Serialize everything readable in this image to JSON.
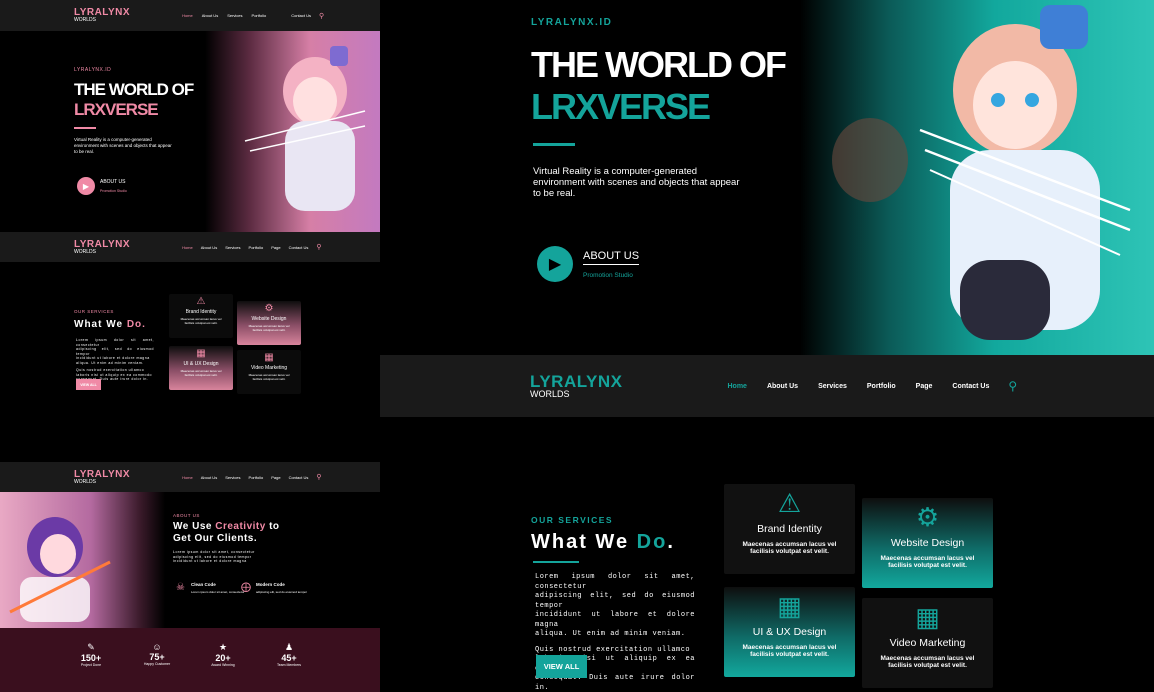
{
  "brand": {
    "name": "LYRALYNX",
    "sub": "WORLDS",
    "tag": "LYRALYNX.ID"
  },
  "hero": {
    "line1": "THE WORLD OF",
    "line2": "LRXVERSE",
    "desc_l1": "Virtual Reality is a computer-generated",
    "desc_l2": "environment with scenes and objects that appear",
    "desc_l3": "to be real.",
    "cta": "ABOUT US",
    "cta_sub": "Promotion Studio"
  },
  "nav_small_1": [
    "Home",
    "About Us",
    "Services",
    "Portfolio",
    "Contact Us"
  ],
  "nav_full": [
    "Home",
    "About Us",
    "Services",
    "Portfolio",
    "Page",
    "Contact Us"
  ],
  "services": {
    "eyebrow": "OUR SERVICES",
    "title_a": "What We ",
    "title_b": "Do",
    "title_c": ".",
    "p1": [
      "Lorem ipsum dolor sit amet, consectetur",
      "adipiscing elit, sed do eiusmod tempor",
      "incididunt ut labore et dolore magna",
      "aliqua. Ut enim ad minim veniam."
    ],
    "p2": [
      "Quis nostrud exercitation ullamco",
      "laboris nisi ut aliquip ex ea commodo",
      "consequat. Duis aute irure dolor in."
    ],
    "btn": "VIEW ALL",
    "items": [
      {
        "title": "Brand Identity",
        "t1": "Maecenas accumsan lacus vel",
        "t2": "facilisis volutpat est velit."
      },
      {
        "title": "Website Design",
        "t1": "Maecenas accumsan lacus vel",
        "t2": "facilisis volutpat est velit."
      },
      {
        "title": "UI & UX Design",
        "t1": "Maecenas accumsan lacus vel",
        "t2": "facilisis volutpat est velit."
      },
      {
        "title": "Video Marketing",
        "t1": "Maecenas accumsan lacus vel",
        "t2": "facilisis volutpat est velit."
      }
    ]
  },
  "about": {
    "eyebrow": "ABOUT US",
    "h1a": "We Use ",
    "h1b": "Creativity",
    "h1c": " to",
    "h2": "Get Our Clients.",
    "f1": "Clean Code",
    "f2": "Modern Code"
  },
  "stats": [
    {
      "num": "150+",
      "label": "Project Done"
    },
    {
      "num": "75+",
      "label": "Happy Customer"
    },
    {
      "num": "20+",
      "label": "Award Winning"
    },
    {
      "num": "45+",
      "label": "Team Members"
    }
  ],
  "colors": {
    "teal": "#14a49b",
    "pink": "#f08aa6",
    "dark": "#1a1a1a",
    "stats_bg": "#3a0f1e"
  }
}
